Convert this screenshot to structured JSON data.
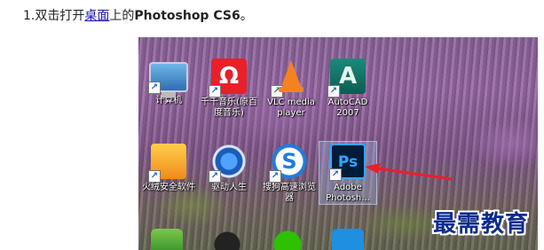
{
  "instruction": {
    "prefix": "1.双击打开",
    "link": "桌面",
    "middle": "上的",
    "app": "Photoshop CS6",
    "suffix": "。"
  },
  "desktop_icons": [
    {
      "label": "计算机",
      "icon": "computer-icon",
      "glyph": ""
    },
    {
      "label": "千千音乐(原百度音乐)",
      "icon": "qianqian-music-icon",
      "glyph": "Ω"
    },
    {
      "label": "VLC media player",
      "icon": "vlc-cone-icon",
      "glyph": ""
    },
    {
      "label": "AutoCAD 2007",
      "icon": "autocad-icon",
      "glyph": "A"
    },
    {
      "label": "火绒安全软件",
      "icon": "huorong-icon",
      "glyph": ""
    },
    {
      "label": "驱动人生",
      "icon": "driver-gear-icon",
      "glyph": ""
    },
    {
      "label": "搜狗高速浏览器",
      "icon": "sogou-browser-icon",
      "glyph": "S"
    },
    {
      "label": "Adobe Photosh...",
      "icon": "photoshop-icon",
      "glyph": "Ps"
    }
  ],
  "shortcut_glyph": "↗",
  "watermark": "最需教育",
  "colors": {
    "link": "#1a0dab",
    "arrow": "#e8202a",
    "watermark": "#0b2b8c",
    "photoshop_blue": "#31a8ff"
  }
}
